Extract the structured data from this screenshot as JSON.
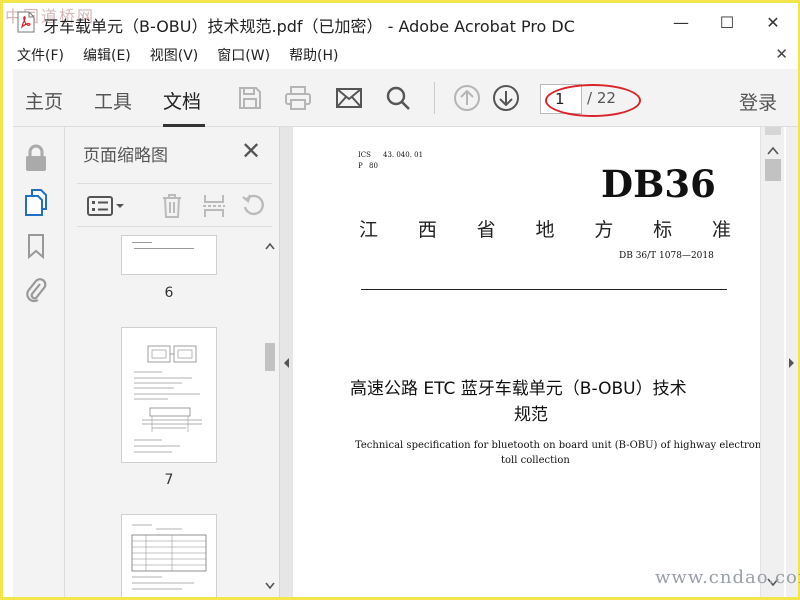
{
  "window": {
    "title": "牙车载单元（B-OBU）技术规范.pdf（已加密） - Adobe Acrobat Pro DC",
    "minimize": "—",
    "maximize": "☐",
    "close": "✕"
  },
  "watermarks": {
    "top_left": "中国道桥网",
    "bottom_right": "www.cndao.com"
  },
  "menu": {
    "items": [
      "文件(F)",
      "编辑(E)",
      "视图(V)",
      "窗口(W)",
      "帮助(H)"
    ],
    "close": "✕"
  },
  "toolbar": {
    "tabs": [
      "主页",
      "工具",
      "文档"
    ],
    "active_tab": "文档",
    "icons": [
      "save-icon",
      "print-icon",
      "email-icon",
      "search-icon",
      "page-up-icon",
      "page-down-icon"
    ],
    "current_page": "1",
    "total_pages": "/ 22",
    "login": "登录"
  },
  "nav_rail": {
    "icons": [
      "lock-icon",
      "page-thumbnails-icon",
      "bookmark-icon",
      "attachment-icon"
    ]
  },
  "thumbnail_panel": {
    "title": "页面缩略图",
    "close": "✕",
    "tools": [
      "options-menu-icon",
      "delete-icon",
      "extract-icon",
      "rotate-icon"
    ],
    "pages": [
      "6",
      "7",
      ""
    ]
  },
  "document": {
    "ics": "ICS",
    "ics_code": "43. 040. 01",
    "p_code_label": "P",
    "p_code": "80",
    "standard_code": "DB36",
    "province_standard": [
      "江",
      "西",
      "省",
      "地",
      "方",
      "标",
      "准"
    ],
    "doc_number": "DB 36/T 1078—2018",
    "title_cn_line1": "高速公路 ETC 蓝牙车载单元（B-OBU）技术",
    "title_cn_line2": "规范",
    "title_en_line1": "Technical specification for bluetooth on board unit (B-OBU) of highway electronic",
    "title_en_line2": "toll collection"
  },
  "colors": {
    "frame": "#f4e64a",
    "annotation": "#d8242a",
    "toolbar_bg": "#f3f3f3",
    "active_icon": "#1f6fc5"
  }
}
